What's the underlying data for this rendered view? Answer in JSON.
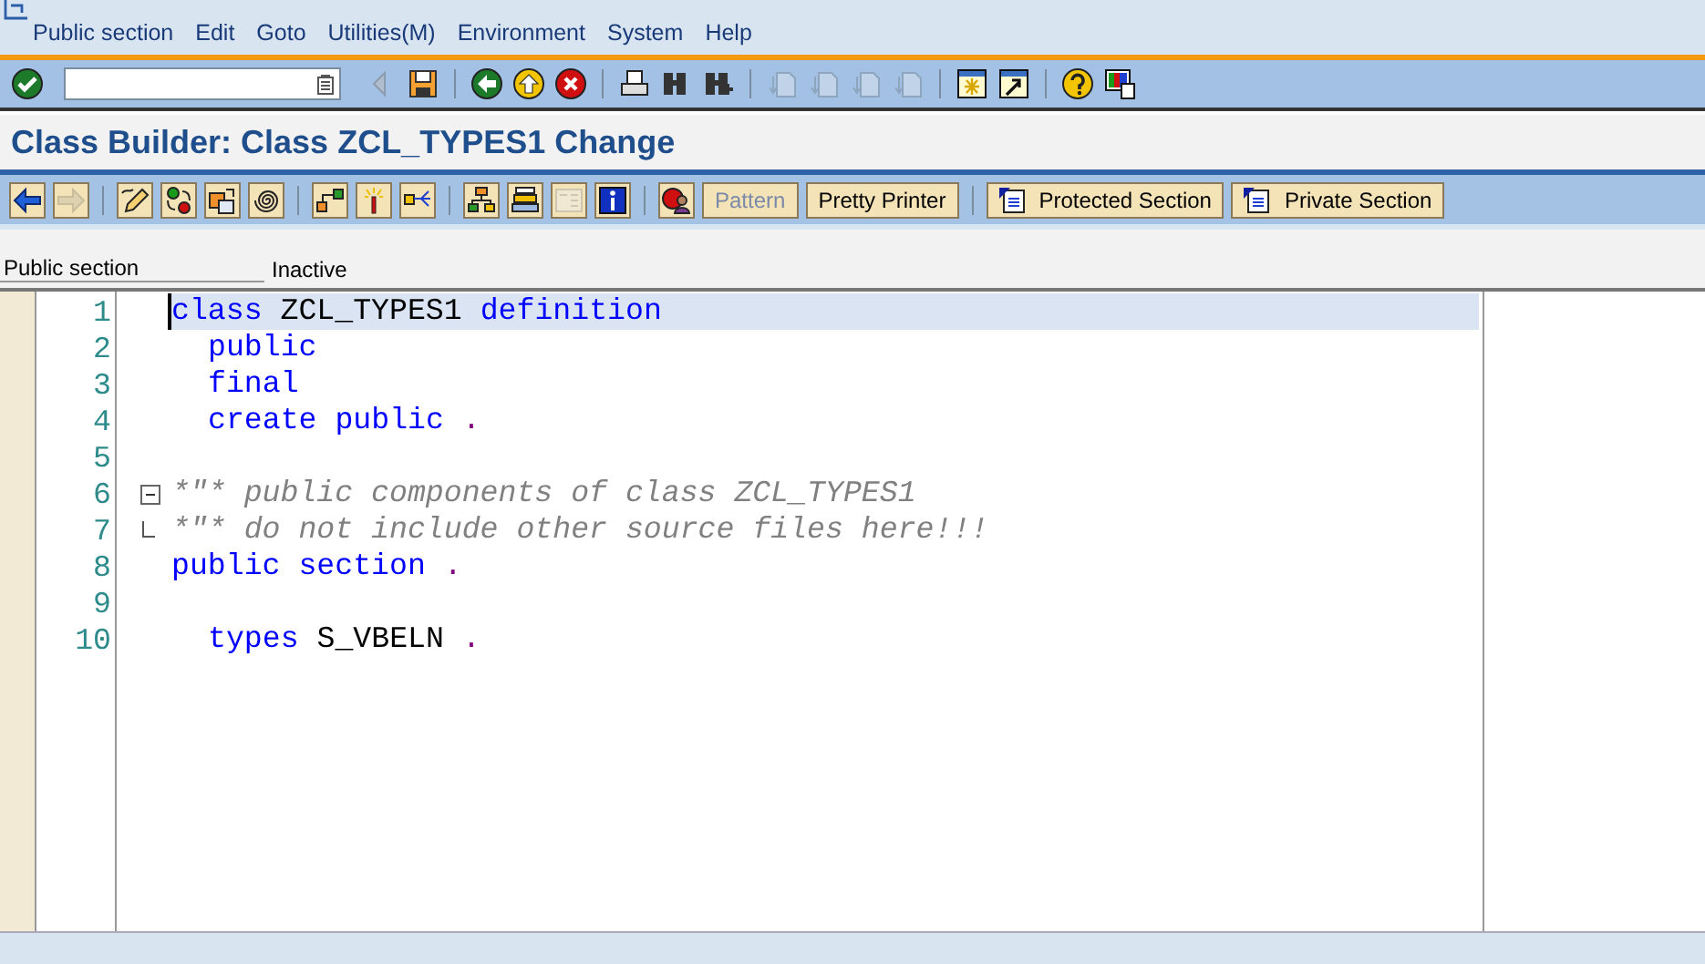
{
  "menu_bar": {
    "items": [
      "Public section",
      "Edit",
      "Goto",
      "Utilities(M)",
      "Environment",
      "System",
      "Help"
    ]
  },
  "standard_toolbar": {
    "groups": [
      [
        {
          "kind": "check",
          "disabled": false
        },
        {
          "kind": "command-field",
          "disabled": false
        },
        {
          "kind": "triangle-left",
          "disabled": true
        },
        {
          "kind": "save",
          "disabled": false
        }
      ],
      [
        {
          "kind": "back",
          "disabled": false
        },
        {
          "kind": "up",
          "disabled": false
        },
        {
          "kind": "cancel",
          "disabled": false
        }
      ],
      [
        {
          "kind": "print",
          "disabled": false
        },
        {
          "kind": "find",
          "disabled": false
        },
        {
          "kind": "find-next",
          "disabled": false
        }
      ],
      [
        {
          "kind": "page-first",
          "disabled": true
        },
        {
          "kind": "page-up",
          "disabled": true
        },
        {
          "kind": "page-down",
          "disabled": true
        },
        {
          "kind": "page-last",
          "disabled": true
        }
      ],
      [
        {
          "kind": "new-window",
          "disabled": false
        },
        {
          "kind": "shortcut",
          "disabled": false
        }
      ],
      [
        {
          "kind": "help",
          "disabled": false
        },
        {
          "kind": "layout",
          "disabled": false
        }
      ]
    ]
  },
  "title": "Class Builder: Class ZCL_TYPES1 Change",
  "application_toolbar": {
    "groups": [
      [
        {
          "kind": "arrow-left",
          "disabled": false
        },
        {
          "kind": "arrow-right",
          "disabled": true
        }
      ],
      [
        {
          "kind": "pencil",
          "disabled": false
        },
        {
          "kind": "dots",
          "disabled": false
        },
        {
          "kind": "copy",
          "disabled": false
        },
        {
          "kind": "spiral",
          "disabled": false
        }
      ],
      [
        {
          "kind": "branch",
          "disabled": false
        },
        {
          "kind": "wand",
          "disabled": false
        },
        {
          "kind": "fork",
          "disabled": false
        }
      ],
      [
        {
          "kind": "tree",
          "disabled": false
        },
        {
          "kind": "stack",
          "disabled": false
        },
        {
          "kind": "form",
          "disabled": true
        },
        {
          "kind": "info",
          "disabled": false
        }
      ],
      [
        {
          "kind": "stop",
          "disabled": false
        },
        {
          "kind": "text",
          "label": "Pattern",
          "disabled": true
        },
        {
          "kind": "text",
          "label": "Pretty Printer",
          "disabled": false
        }
      ],
      [
        {
          "kind": "text-icon",
          "label": "Protected Section",
          "disabled": false
        },
        {
          "kind": "text-icon",
          "label": "Private Section",
          "disabled": false
        }
      ]
    ]
  },
  "section_field": {
    "value": "Public section"
  },
  "status": "Inactive",
  "editor": {
    "lines": [
      {
        "number": "1",
        "selected": true,
        "indented": false,
        "kind": "code",
        "tokens": [
          {
            "kind": "keyword",
            "text": "class"
          },
          {
            "kind": "ident",
            "text": "ZCL_TYPES1"
          },
          {
            "kind": "keyword",
            "text": "definition"
          }
        ]
      },
      {
        "number": "2",
        "selected": false,
        "indented": true,
        "kind": "code",
        "tokens": [
          {
            "kind": "keyword",
            "text": "public"
          }
        ]
      },
      {
        "number": "3",
        "selected": false,
        "indented": true,
        "kind": "code",
        "tokens": [
          {
            "kind": "keyword",
            "text": "final"
          }
        ]
      },
      {
        "number": "4",
        "selected": false,
        "indented": true,
        "kind": "code",
        "tokens": [
          {
            "kind": "keyword",
            "text": "create"
          },
          {
            "kind": "keyword",
            "text": "public"
          },
          {
            "kind": "punct",
            "text": "."
          }
        ]
      },
      {
        "number": "5",
        "kind": "code"
      },
      {
        "number": "6",
        "selected": false,
        "indented": false,
        "kind": "fold-start",
        "tokens": [
          {
            "kind": "comment",
            "text": "*\"* public components of class ZCL_TYPES1"
          }
        ]
      },
      {
        "number": "7",
        "selected": false,
        "indented": false,
        "kind": "fold-end",
        "tokens": [
          {
            "kind": "comment",
            "text": "*\"* do not include other source files here!!!"
          }
        ]
      },
      {
        "number": "8",
        "selected": false,
        "indented": false,
        "kind": "code",
        "tokens": [
          {
            "kind": "keyword",
            "text": "public"
          },
          {
            "kind": "keyword",
            "text": "section"
          },
          {
            "kind": "punct",
            "text": "."
          }
        ]
      },
      {
        "number": "9",
        "kind": "code"
      },
      {
        "number": "10",
        "selected": false,
        "indented": true,
        "kind": "code",
        "tokens": [
          {
            "kind": "keyword",
            "text": "types"
          },
          {
            "kind": "ident",
            "text": "S_VBELN"
          },
          {
            "kind": "punct",
            "text": "."
          }
        ]
      }
    ]
  }
}
